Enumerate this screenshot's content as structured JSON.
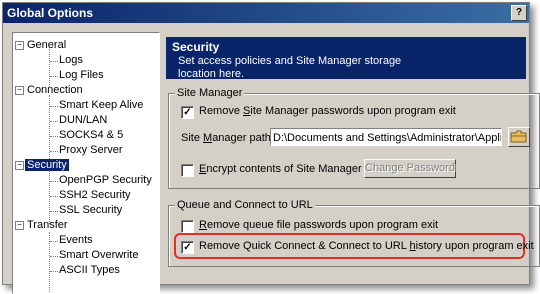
{
  "window": {
    "title": "Global Options",
    "help_glyph": "?"
  },
  "tree": {
    "items": [
      {
        "label": "General",
        "expander": "−",
        "children": [
          "Logs",
          "Log Files"
        ]
      },
      {
        "label": "Connection",
        "expander": "−",
        "children": [
          "Smart Keep Alive",
          "DUN/LAN",
          "SOCKS4 & 5",
          "Proxy Server"
        ]
      },
      {
        "label": "Security",
        "expander": "−",
        "selected": true,
        "children": [
          "OpenPGP Security",
          "SSH2 Security",
          "SSL Security"
        ]
      },
      {
        "label": "Transfer",
        "expander": "−",
        "children": [
          "Events",
          "Smart Overwrite",
          "ASCII Types"
        ]
      }
    ]
  },
  "header": {
    "title": "Security",
    "description": "Set access policies and Site Manager storage location here."
  },
  "site_manager": {
    "legend": "Site Manager",
    "remove_passwords": {
      "pre": "Remove ",
      "ul": "S",
      "post": "ite Manager passwords upon program exit",
      "checked": true
    },
    "path_label": {
      "pre": "Site ",
      "ul": "M",
      "post": "anager path:"
    },
    "path_value": "D:\\Documents and Settings\\Administrator\\Applic",
    "encrypt": {
      "pre": "",
      "ul": "E",
      "post": "ncrypt contents of Site Manager",
      "checked": false
    },
    "change_password_button": "Change Password"
  },
  "queue": {
    "legend": "Queue and Connect to URL",
    "remove_queue": {
      "pre": "",
      "ul": "R",
      "post": "emove queue file passwords upon program exit",
      "checked": false
    },
    "remove_quick": {
      "pre": "Remove Quick Connect & Connect to URL ",
      "ul": "h",
      "post": "istory upon program exit",
      "checked": true
    }
  },
  "check_glyph": "✓",
  "colors": {
    "title_bar": "#0a246a",
    "selection": "#0a246a",
    "highlight_outline": "#e0301e",
    "dialog_face": "#d4d0c8"
  }
}
